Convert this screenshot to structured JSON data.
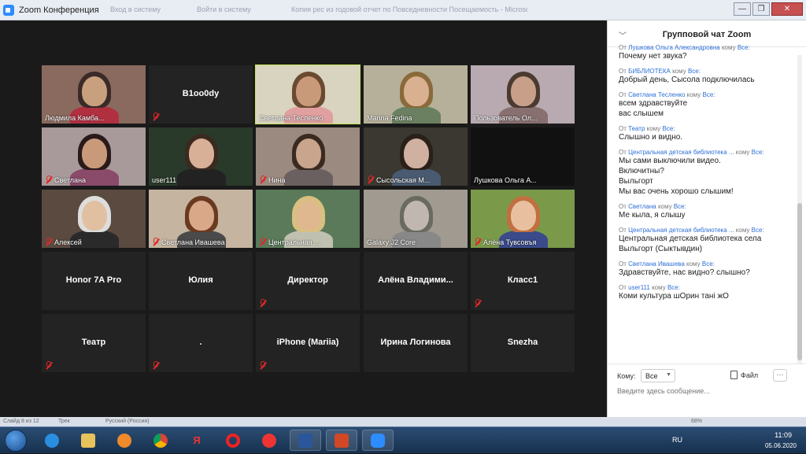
{
  "window": {
    "title": "Zoom Конференция",
    "ghost_tab1": "Вход в систему",
    "ghost_tab2": "Войти в систему",
    "ghost_tab3": "Копия рес из годовой отчет по Повседневности Посещаемость - Microsoft PowerPoint...",
    "minimize": "—",
    "restore": "❐",
    "close": "✕"
  },
  "video_tiles": [
    {
      "name": "Людмила Камба...",
      "has_video": true,
      "muted": false
    },
    {
      "name": "B1oo0dy",
      "has_video": false,
      "muted": true
    },
    {
      "name": "Светлана Тесленко",
      "has_video": true,
      "muted": false,
      "active": true
    },
    {
      "name": "Marina Fedina",
      "has_video": true,
      "muted": false
    },
    {
      "name": "Пользователь Ол...",
      "has_video": true,
      "muted": false
    },
    {
      "name": "Светлана",
      "has_video": true,
      "muted": true
    },
    {
      "name": "user111",
      "has_video": true,
      "muted": false
    },
    {
      "name": "Нина",
      "has_video": true,
      "muted": true
    },
    {
      "name": "Сысольская М...",
      "has_video": true,
      "muted": true
    },
    {
      "name": "Лушкова Ольга А...",
      "has_video": true,
      "muted": false
    },
    {
      "name": "Алексей",
      "has_video": true,
      "muted": true
    },
    {
      "name": "Светлана Ивашева",
      "has_video": true,
      "muted": true
    },
    {
      "name": "Центральная ...",
      "has_video": true,
      "muted": true
    },
    {
      "name": "Galaxy J2 Core",
      "has_video": true,
      "muted": false
    },
    {
      "name": "Алёна Тувсовъя",
      "has_video": true,
      "muted": true
    },
    {
      "name": "Honor 7A Pro",
      "has_video": false,
      "muted": false
    },
    {
      "name": "Юлия",
      "has_video": false,
      "muted": false
    },
    {
      "name": "Директор",
      "has_video": false,
      "muted": true
    },
    {
      "name": "Алёна Владими...",
      "has_video": false,
      "muted": false
    },
    {
      "name": "Класс1",
      "has_video": false,
      "muted": true
    },
    {
      "name": "Театр",
      "has_video": false,
      "muted": true
    },
    {
      "name": ".",
      "has_video": false,
      "muted": true
    },
    {
      "name": "iPhone (Mariia)",
      "has_video": false,
      "muted": true
    },
    {
      "name": "Ирина Логинова",
      "has_video": false,
      "muted": false
    },
    {
      "name": "Snezha",
      "has_video": false,
      "muted": false
    }
  ],
  "chat": {
    "title": "Групповой чат Zoom",
    "from_word": "От",
    "to_word": "кому",
    "messages": [
      {
        "sender": "Лушкова Ольга Александровна",
        "recipient": "Все:",
        "lines": [
          "Почему нет звука?"
        ]
      },
      {
        "sender": "БИБЛИОТЕКА",
        "recipient": "Все:",
        "lines": [
          "Добрый день, Сысола подключилась"
        ]
      },
      {
        "sender": "Светлана Тесленко",
        "recipient": "Все:",
        "lines": [
          "всем здравствуйте",
          "вас слышем"
        ]
      },
      {
        "sender": "Театр",
        "recipient": "Все:",
        "lines": [
          "Слышно и видно."
        ]
      },
      {
        "sender": "Центральная детская библиотека ...",
        "recipient": "Все:",
        "lines": [
          "Мы сами выключили видео.",
          "Включитны?",
          "Выльгорт",
          "Мы вас очень хорошо слышим!"
        ]
      },
      {
        "sender": "Светлана",
        "recipient": "Все:",
        "lines": [
          "Ме кыла, я слышу"
        ]
      },
      {
        "sender": "Центральная детская библиотека ...",
        "recipient": "Все:",
        "lines": [
          "Центральная детская библиотека села",
          "Выльгорт (Сыктывдин)"
        ]
      },
      {
        "sender": "Светлана Ивашева",
        "recipient": "Все:",
        "lines": [
          "Здравствуйте, нас видно? слышно?"
        ]
      },
      {
        "sender": "user111",
        "recipient": "Все:",
        "lines": [
          "Коми культура шОрин тані жО"
        ]
      }
    ],
    "to_label": "Кому:",
    "to_value": "Все",
    "file_label": "Файл",
    "more_label": "···",
    "input_placeholder": "Введите здесь сообщение..."
  },
  "status_strip": {
    "slide": "Слайд 8 из 12",
    "theme": "Трек",
    "lang": "Русский (Россия)",
    "zoom": "68%"
  },
  "taskbar": {
    "lang": "RU",
    "time": "11:09",
    "date": "05.06.2020",
    "apps": [
      "ie",
      "explorer",
      "media",
      "chrome",
      "yandex-browser",
      "opera",
      "yandex",
      "word",
      "powerpoint",
      "zoom"
    ]
  }
}
